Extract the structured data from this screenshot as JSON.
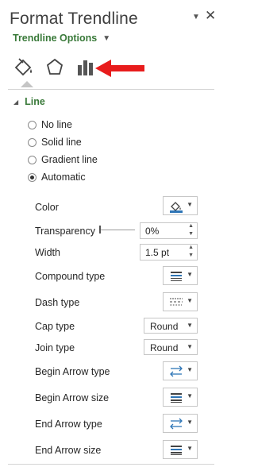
{
  "pane": {
    "title": "Format Trendline",
    "options_label": "Trendline Options"
  },
  "tabs": [
    {
      "name": "fill-line",
      "icon": "paint-bucket-icon",
      "selected": true
    },
    {
      "name": "effects",
      "icon": "pentagon-icon",
      "selected": false
    },
    {
      "name": "trendline-options",
      "icon": "bar-chart-icon",
      "selected": false
    }
  ],
  "annotation": {
    "icon": "red-arrow-icon",
    "color": "#e81c1c"
  },
  "section": {
    "label": "Line",
    "expanded": true
  },
  "line_options": [
    {
      "label": "No line",
      "checked": false
    },
    {
      "label": "Solid line",
      "checked": false
    },
    {
      "label": "Gradient line",
      "checked": false
    },
    {
      "label": "Automatic",
      "checked": true
    }
  ],
  "properties": {
    "color": {
      "label": "Color"
    },
    "transparency": {
      "label": "Transparency",
      "value": "0%",
      "level": 0
    },
    "width": {
      "label": "Width",
      "value": "1.5 pt"
    },
    "compound_type": {
      "label": "Compound type"
    },
    "dash_type": {
      "label": "Dash type"
    },
    "cap_type": {
      "label": "Cap type",
      "value": "Round"
    },
    "join_type": {
      "label": "Join type",
      "value": "Round"
    },
    "begin_arrow_type": {
      "label": "Begin Arrow type"
    },
    "begin_arrow_size": {
      "label": "Begin Arrow size"
    },
    "end_arrow_type": {
      "label": "End Arrow type"
    },
    "end_arrow_size": {
      "label": "End Arrow size"
    }
  },
  "colors": {
    "accent_green": "#3a7a3a",
    "arrow_red": "#e81c1c",
    "icon_blue": "#2e75b6"
  }
}
